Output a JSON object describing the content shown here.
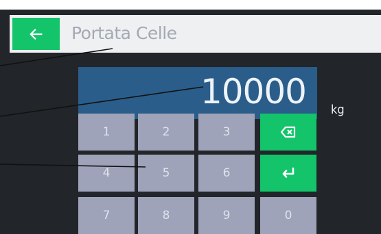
{
  "header": {
    "title": "Portata Celle",
    "back_icon": "arrow-left-icon"
  },
  "display": {
    "value": "10000",
    "unit": "kg"
  },
  "keypad": {
    "keys": [
      "1",
      "2",
      "3",
      "4",
      "5",
      "6",
      "7",
      "8",
      "9",
      "0"
    ],
    "backspace_icon": "backspace-icon",
    "enter_icon": "enter-icon"
  },
  "colors": {
    "accent_green": "#13c46a",
    "display_blue": "#2a5d8a",
    "key_gray": "#9fa3b9",
    "screen_dark": "#222529"
  }
}
